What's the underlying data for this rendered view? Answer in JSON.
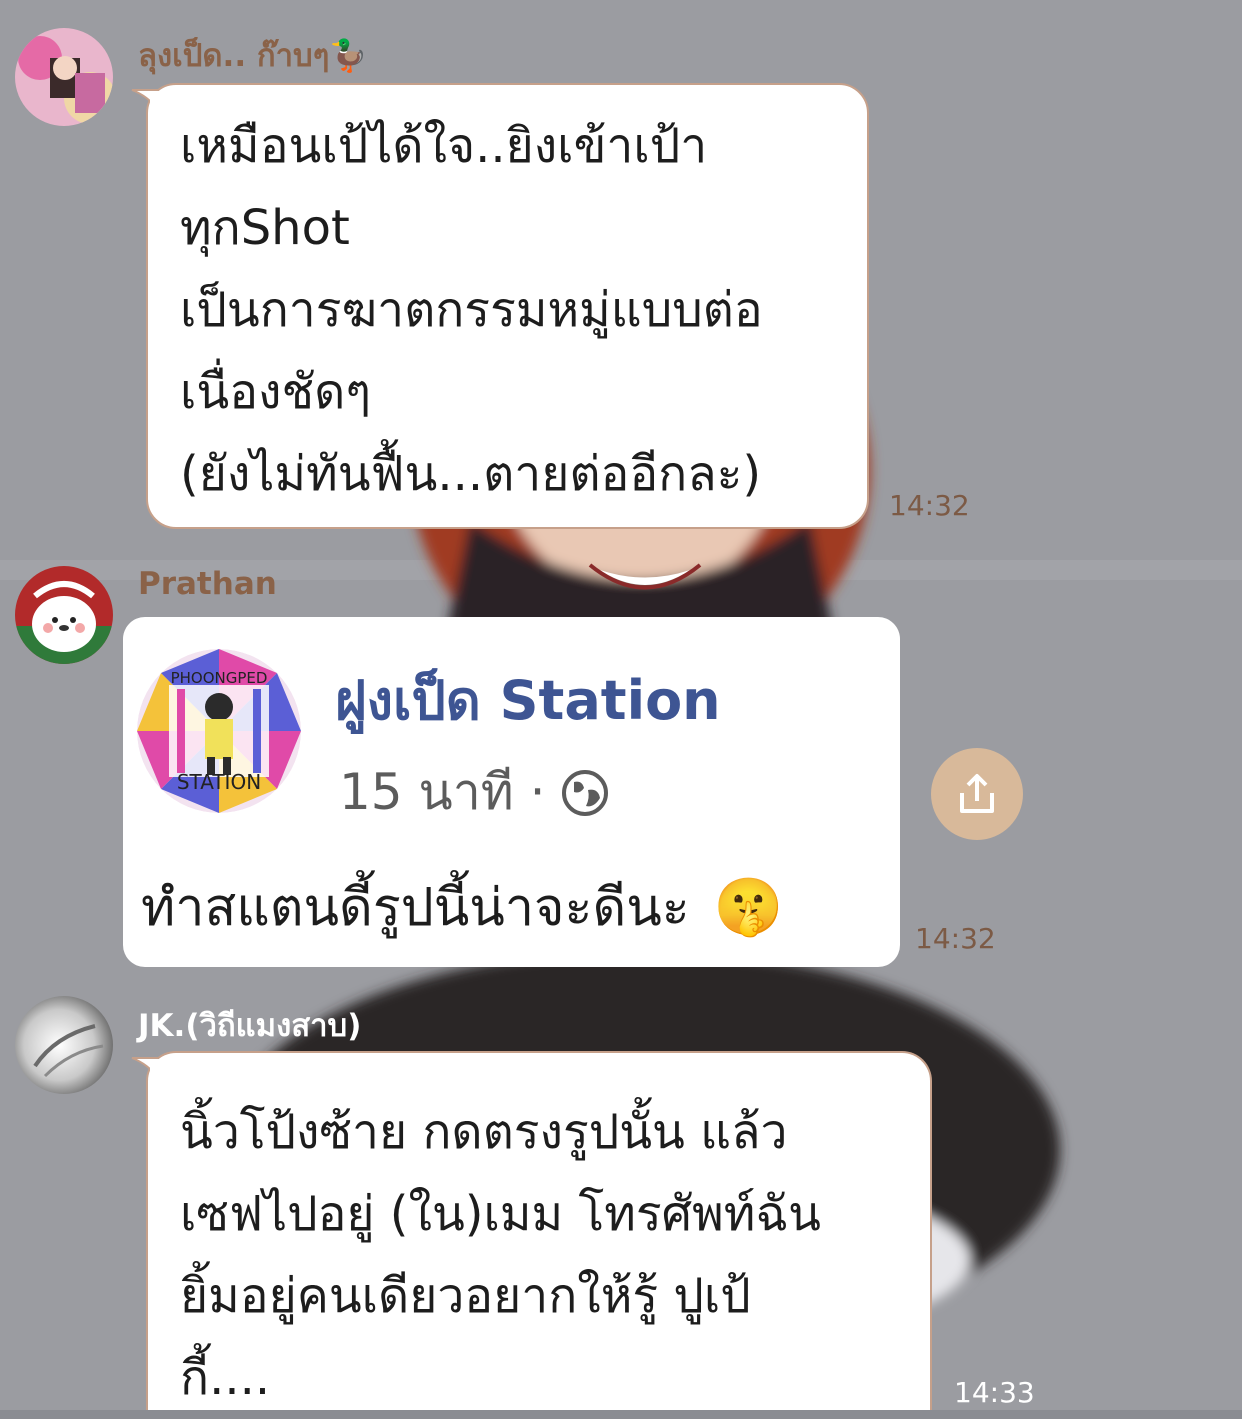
{
  "messages": [
    {
      "sender": "ลุงเป็ด.. ก๊าบๆ🦆",
      "lines": [
        "เหมือนเป้ได้ใจ..ยิงเข้าเป้า",
        "ทุกShot",
        "เป็นการฆาตกรรมหมู่แบบต่อ",
        "เนื่องชัดๆ",
        "(ยังไม่ทันฟื้น...ตายต่ออีกละ)"
      ],
      "time": "14:32"
    },
    {
      "sender": "Prathan",
      "shared_post": {
        "logo_top": "PHOONGPED",
        "logo_bottom": "STATION",
        "page_name": "ฝูงเป็ด Station",
        "meta": "15 นาที ·",
        "text": "ทำสแตนดี้รูปนี้น่าจะดีนะ",
        "emoji": "🤫"
      },
      "time": "14:32"
    },
    {
      "sender": "JK.(วิถีแมงสาบ)",
      "lines": [
        "นิ้วโป้งซ้าย กดตรงรูปนั้น แล้ว",
        "เซฟไปอยู่ (ใน)เมม โทรศัพท์ฉัน",
        "ยิ้มอยู่คนเดียวอยากให้รู้ ปูเป้",
        "กี้...."
      ],
      "time": "14:33"
    }
  ],
  "colors": {
    "bubble_border": "#c6a08a",
    "sender_text": "#8a6248",
    "time_text": "#7c5a45",
    "share_button": "#d8b99a",
    "post_title": "#3e5593"
  },
  "icons": [
    "share-icon",
    "globe-icon"
  ]
}
